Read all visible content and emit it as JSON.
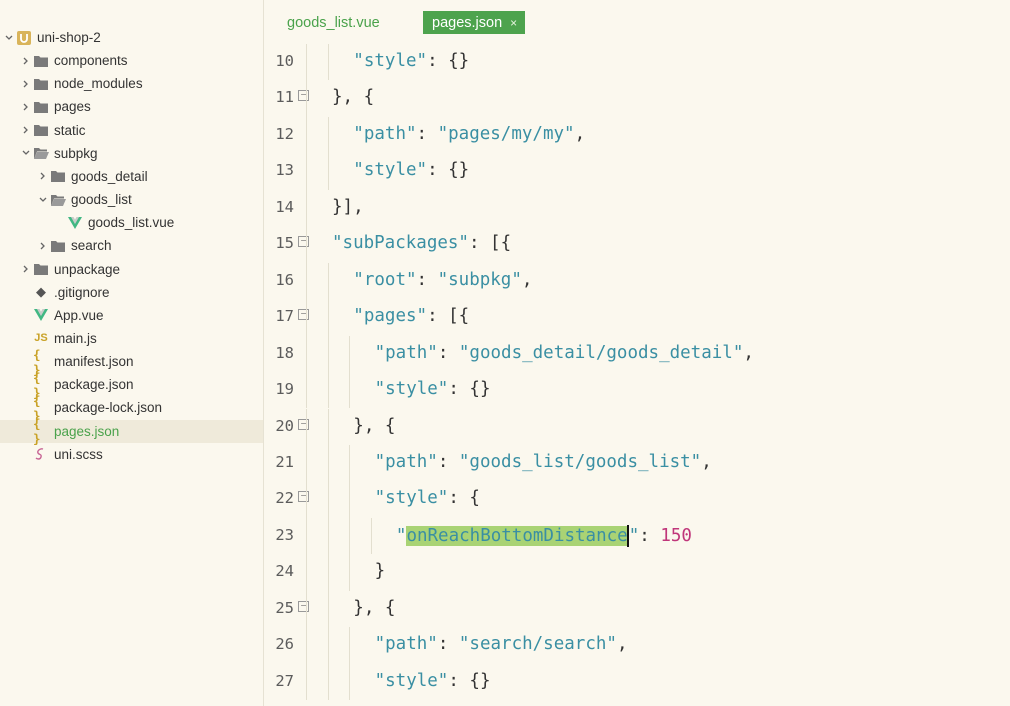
{
  "tree": [
    {
      "label": "uni-shop-2",
      "icon": "uni-project-icon",
      "indent": 0,
      "chevron": "down",
      "selected": false
    },
    {
      "label": "components",
      "icon": "folder-icon",
      "indent": 1,
      "chevron": "right",
      "selected": false
    },
    {
      "label": "node_modules",
      "icon": "folder-icon",
      "indent": 1,
      "chevron": "right",
      "selected": false
    },
    {
      "label": "pages",
      "icon": "folder-icon",
      "indent": 1,
      "chevron": "right",
      "selected": false
    },
    {
      "label": "static",
      "icon": "folder-icon",
      "indent": 1,
      "chevron": "right",
      "selected": false
    },
    {
      "label": "subpkg",
      "icon": "folder-open-icon",
      "indent": 1,
      "chevron": "down",
      "selected": false
    },
    {
      "label": "goods_detail",
      "icon": "folder-icon",
      "indent": 2,
      "chevron": "right",
      "selected": false
    },
    {
      "label": "goods_list",
      "icon": "folder-open-icon",
      "indent": 2,
      "chevron": "down",
      "selected": false
    },
    {
      "label": "goods_list.vue",
      "icon": "vue-icon",
      "indent": 3,
      "chevron": "",
      "selected": false
    },
    {
      "label": "search",
      "icon": "folder-icon",
      "indent": 2,
      "chevron": "right",
      "selected": false
    },
    {
      "label": "unpackage",
      "icon": "folder-icon",
      "indent": 1,
      "chevron": "right",
      "selected": false
    },
    {
      "label": ".gitignore",
      "icon": "git-icon",
      "indent": 1,
      "chevron": "",
      "selected": false
    },
    {
      "label": "App.vue",
      "icon": "vue-icon",
      "indent": 1,
      "chevron": "",
      "selected": false
    },
    {
      "label": "main.js",
      "icon": "js-icon",
      "indent": 1,
      "chevron": "",
      "selected": false
    },
    {
      "label": "manifest.json",
      "icon": "json-icon",
      "indent": 1,
      "chevron": "",
      "selected": false
    },
    {
      "label": "package.json",
      "icon": "json-icon",
      "indent": 1,
      "chevron": "",
      "selected": false
    },
    {
      "label": "package-lock.json",
      "icon": "json-icon",
      "indent": 1,
      "chevron": "",
      "selected": false
    },
    {
      "label": "pages.json",
      "icon": "json-icon",
      "indent": 1,
      "chevron": "",
      "selected": true
    },
    {
      "label": "uni.scss",
      "icon": "scss-icon",
      "indent": 1,
      "chevron": "",
      "selected": false
    }
  ],
  "tabs": [
    {
      "label": "goods_list.vue",
      "active": false
    },
    {
      "label": "pages.json",
      "active": true,
      "close": "×"
    }
  ],
  "code_lines": [
    {
      "num": "10",
      "fold": false,
      "indent": 1,
      "tokens": [
        [
          "s",
          "\"style\""
        ],
        [
          "k",
          ": {}"
        ]
      ]
    },
    {
      "num": "11",
      "fold": true,
      "indent": 0,
      "tokens": [
        [
          "k",
          "}, {"
        ]
      ]
    },
    {
      "num": "12",
      "fold": false,
      "indent": 1,
      "tokens": [
        [
          "s",
          "\"path\""
        ],
        [
          "k",
          ": "
        ],
        [
          "s",
          "\"pages/my/my\""
        ],
        [
          "k",
          ","
        ]
      ]
    },
    {
      "num": "13",
      "fold": false,
      "indent": 1,
      "tokens": [
        [
          "s",
          "\"style\""
        ],
        [
          "k",
          ": {}"
        ]
      ]
    },
    {
      "num": "14",
      "fold": false,
      "indent": 0,
      "tokens": [
        [
          "k",
          "}],"
        ]
      ]
    },
    {
      "num": "15",
      "fold": true,
      "indent": 0,
      "tokens": [
        [
          "s",
          "\"subPackages\""
        ],
        [
          "k",
          ": [{"
        ]
      ]
    },
    {
      "num": "16",
      "fold": false,
      "indent": 1,
      "tokens": [
        [
          "s",
          "\"root\""
        ],
        [
          "k",
          ": "
        ],
        [
          "s",
          "\"subpkg\""
        ],
        [
          "k",
          ","
        ]
      ]
    },
    {
      "num": "17",
      "fold": true,
      "indent": 1,
      "tokens": [
        [
          "s",
          "\"pages\""
        ],
        [
          "k",
          ": [{"
        ]
      ]
    },
    {
      "num": "18",
      "fold": false,
      "indent": 2,
      "tokens": [
        [
          "s",
          "\"path\""
        ],
        [
          "k",
          ": "
        ],
        [
          "s",
          "\"goods_detail/goods_detail\""
        ],
        [
          "k",
          ","
        ]
      ]
    },
    {
      "num": "19",
      "fold": false,
      "indent": 2,
      "tokens": [
        [
          "s",
          "\"style\""
        ],
        [
          "k",
          ": {}"
        ]
      ]
    },
    {
      "num": "20",
      "fold": true,
      "indent": 1,
      "tokens": [
        [
          "k",
          "}, {"
        ]
      ]
    },
    {
      "num": "21",
      "fold": false,
      "indent": 2,
      "tokens": [
        [
          "s",
          "\"path\""
        ],
        [
          "k",
          ": "
        ],
        [
          "s",
          "\"goods_list/goods_list\""
        ],
        [
          "k",
          ","
        ]
      ]
    },
    {
      "num": "22",
      "fold": true,
      "indent": 2,
      "tokens": [
        [
          "s",
          "\"style\""
        ],
        [
          "k",
          ": {"
        ]
      ]
    },
    {
      "num": "23",
      "fold": false,
      "indent": 3,
      "tokens": [
        [
          "s",
          "\""
        ],
        [
          "hl",
          "onReachBottomDistance"
        ],
        [
          "caret",
          ""
        ],
        [
          "s",
          "\""
        ],
        [
          "k",
          ": "
        ],
        [
          "n",
          "150"
        ]
      ]
    },
    {
      "num": "24",
      "fold": false,
      "indent": 2,
      "tokens": [
        [
          "k",
          "}"
        ]
      ]
    },
    {
      "num": "25",
      "fold": true,
      "indent": 1,
      "tokens": [
        [
          "k",
          "}, {"
        ]
      ]
    },
    {
      "num": "26",
      "fold": false,
      "indent": 2,
      "tokens": [
        [
          "s",
          "\"path\""
        ],
        [
          "k",
          ": "
        ],
        [
          "s",
          "\"search/search\""
        ],
        [
          "k",
          ","
        ]
      ]
    },
    {
      "num": "27",
      "fold": false,
      "indent": 2,
      "tokens": [
        [
          "s",
          "\"style\""
        ],
        [
          "k",
          ": {}"
        ]
      ]
    }
  ],
  "colors": {
    "accent": "#4aa24b",
    "string": "#3a8fa3",
    "number": "#c0367a",
    "selection": "#a9d374"
  }
}
